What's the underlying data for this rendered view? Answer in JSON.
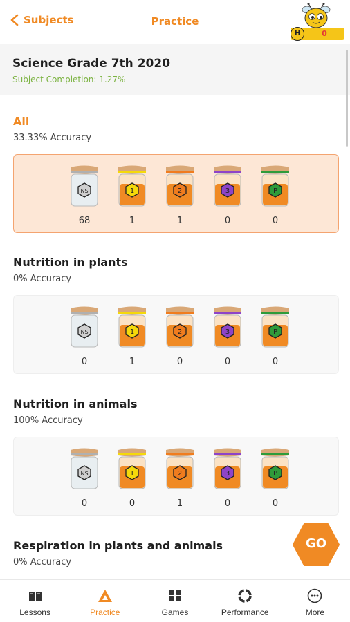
{
  "header": {
    "back_label": "Subjects",
    "title": "Practice",
    "coins": "0",
    "coin_letter": "H"
  },
  "subject": {
    "title": "Science Grade 7th 2020",
    "completion": "Subject Completion: 1.27%"
  },
  "jar_labels": [
    "NS",
    "1",
    "2",
    "3",
    "P"
  ],
  "jar_colors": {
    "lid": "#d9a877",
    "ns_band": "#b0b0b0",
    "l1_band": "#f5d90a",
    "l2_band": "#f07c1e",
    "l3_band": "#8e44c8",
    "p_band": "#2e9b3a",
    "honey": "#f08a24"
  },
  "sections": [
    {
      "title": "All",
      "accuracy": "33.33% Accuracy",
      "counts": [
        "68",
        "1",
        "1",
        "0",
        "0"
      ],
      "active": true
    },
    {
      "title": "Nutrition in plants",
      "accuracy": "0% Accuracy",
      "counts": [
        "0",
        "1",
        "0",
        "0",
        "0"
      ],
      "active": false
    },
    {
      "title": "Nutrition in animals",
      "accuracy": "100% Accuracy",
      "counts": [
        "0",
        "0",
        "1",
        "0",
        "0"
      ],
      "active": false
    },
    {
      "title": "Respiration in plants and animals",
      "accuracy": "0% Accuracy",
      "counts": [],
      "active": false
    }
  ],
  "go_label": "GO",
  "tabs": [
    {
      "label": "Lessons",
      "icon": "book-icon"
    },
    {
      "label": "Practice",
      "icon": "triangle-icon"
    },
    {
      "label": "Games",
      "icon": "puzzle-icon"
    },
    {
      "label": "Performance",
      "icon": "performance-ring-icon"
    },
    {
      "label": "More",
      "icon": "more-dots-icon"
    }
  ]
}
